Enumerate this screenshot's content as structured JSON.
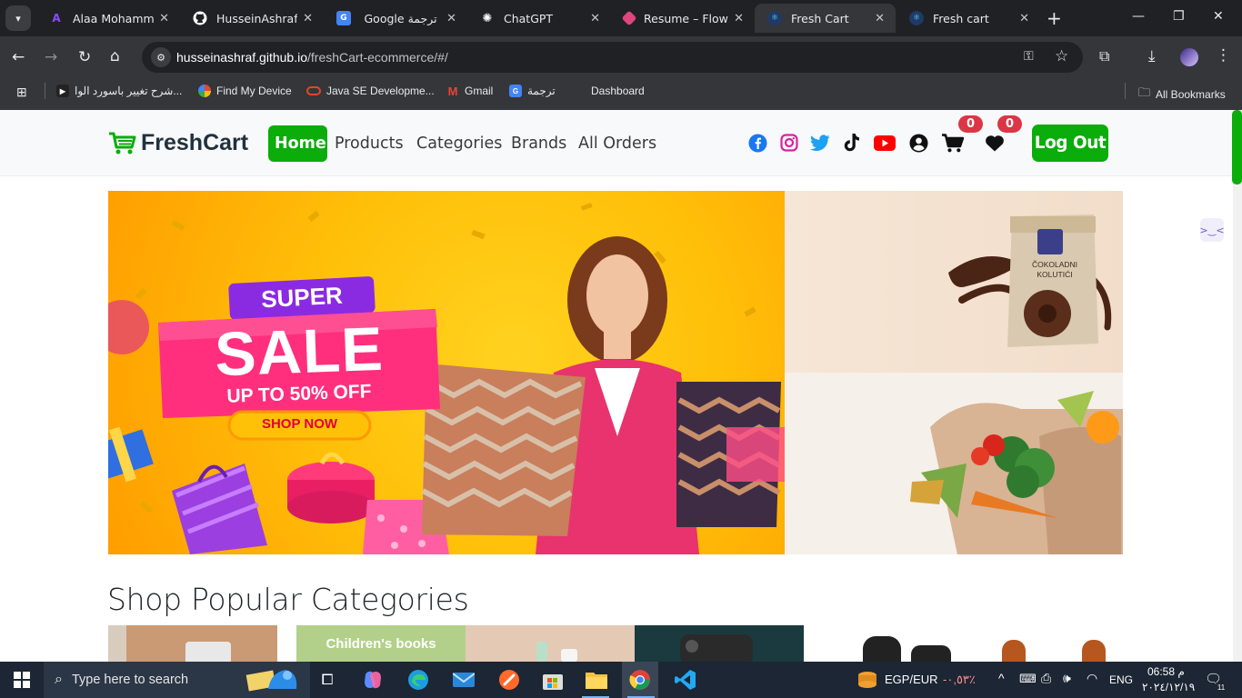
{
  "browser": {
    "tabs": [
      {
        "title": "Alaa Mohammed",
        "favicon": "aa-icon",
        "color": "#6b2fbf"
      },
      {
        "title": "HusseinAshraf (H",
        "favicon": "github-icon",
        "color": "#ffffff"
      },
      {
        "title": "Google ترجمة",
        "favicon": "google-translate-icon",
        "color": "#4285f4"
      },
      {
        "title": "ChatGPT",
        "favicon": "chatgpt-icon",
        "color": "#ffffff"
      },
      {
        "title": "Resume – FlowC",
        "favicon": "flowcv-icon",
        "color": "#e0457b"
      },
      {
        "title": "Fresh Cart",
        "favicon": "react-icon",
        "color": "#61dafb",
        "active": true
      },
      {
        "title": "Fresh cart",
        "favicon": "react-icon",
        "color": "#61dafb"
      }
    ],
    "url_domain": "husseinashraf.github.io",
    "url_path": "/freshCart-ecommerce/#/",
    "bookmarks": [
      {
        "label": "شرح تغيير باسورد الوا..."
      },
      {
        "label": "Find My Device"
      },
      {
        "label": "Java SE Developme..."
      },
      {
        "label": "Gmail"
      },
      {
        "label": "ترجمة"
      },
      {
        "label": "Dashboard"
      }
    ],
    "all_bookmarks": "All Bookmarks"
  },
  "navbar": {
    "brand": "FreshCart",
    "links": [
      "Home",
      "Products",
      "Categories",
      "Brands",
      "All Orders"
    ],
    "active_link": "Home",
    "cart_count": "0",
    "wishlist_count": "0",
    "logout": "Log Out",
    "accent": "#0aad0a"
  },
  "hero": {
    "badge_top": "SUPER",
    "headline": "SALE",
    "offer": "UP TO 50% OFF",
    "cta": "SHOP NOW",
    "product_text_1": "ČOKOLADNI",
    "product_text_2": "KOLUTIĆI"
  },
  "section": {
    "title": "Shop Popular Categories",
    "category_banner": "Children's books"
  },
  "taskbar": {
    "search_placeholder": "Type here to search",
    "currency": "EGP/EUR",
    "currency_change": "-٠,٥٣٪",
    "language": "ENG",
    "time": "06:58 م",
    "date": "٢٠٢٤/١٢/١٩",
    "notifications": "11"
  }
}
